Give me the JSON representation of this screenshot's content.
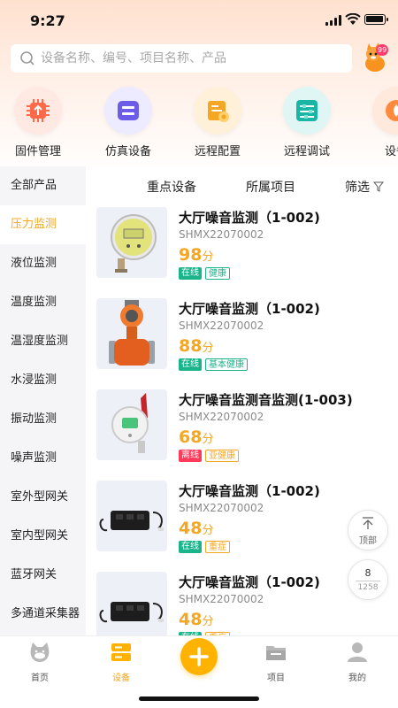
{
  "status_bar": {
    "time": "9:27"
  },
  "search": {
    "placeholder": "设备名称、编号、项目名称、产品",
    "badge": "99"
  },
  "quick_menu": [
    {
      "label": "固件管理",
      "icon": "firmware-icon"
    },
    {
      "label": "仿真设备",
      "icon": "simulated-device-icon"
    },
    {
      "label": "远程配置",
      "icon": "remote-config-icon"
    },
    {
      "label": "远程调试",
      "icon": "remote-debug-icon"
    },
    {
      "label": "设备",
      "icon": "device-icon"
    }
  ],
  "sidebar": {
    "items": [
      {
        "label": "全部产品",
        "active": false
      },
      {
        "label": "压力监测",
        "active": true
      },
      {
        "label": "液位监测",
        "active": false
      },
      {
        "label": "温度监测",
        "active": false
      },
      {
        "label": "温湿度监测",
        "active": false
      },
      {
        "label": "水浸监测",
        "active": false
      },
      {
        "label": "振动监测",
        "active": false
      },
      {
        "label": "噪声监测",
        "active": false
      },
      {
        "label": "室外型网关",
        "active": false
      },
      {
        "label": "室内型网关",
        "active": false
      },
      {
        "label": "蓝牙网关",
        "active": false
      },
      {
        "label": "多通道采集器",
        "active": false
      }
    ]
  },
  "filters": {
    "key_devices": "重点设备",
    "project": "所属项目",
    "filter": "筛选"
  },
  "products": [
    {
      "name": "大厅噪音监测（1-002)",
      "code": "SHMX22070002",
      "score": "98",
      "unit": "分",
      "status": "在线",
      "health": "健康",
      "status_type": "online",
      "health_type": "health",
      "image": "digital-pressure-gauge"
    },
    {
      "name": "大厅噪音监测（1-002)",
      "code": "SHMX22070002",
      "score": "88",
      "unit": "分",
      "status": "在线",
      "health": "基本健康",
      "status_type": "online",
      "health_type": "health",
      "image": "flow-meter"
    },
    {
      "name": "大厅噪音监测音监测(1-003)",
      "code": "SHMX22070002",
      "score": "68",
      "unit": "分",
      "status": "离线",
      "health": "亚健康",
      "status_type": "offline",
      "health_type": "warn",
      "image": "wireless-transmitter"
    },
    {
      "name": "大厅噪音监测（1-002)",
      "code": "SHMX22070002",
      "score": "48",
      "unit": "分",
      "status": "在线",
      "health": "重症",
      "status_type": "online",
      "health_type": "warn",
      "image": "battery-box"
    },
    {
      "name": "大厅噪音监测（1-002)",
      "code": "SHMX22070002",
      "score": "48",
      "unit": "分",
      "status": "在线",
      "health": "重症",
      "status_type": "online",
      "health_type": "warn",
      "image": "battery-box"
    }
  ],
  "float": {
    "top_label": "顶部",
    "page_current": "8",
    "page_total": "1258"
  },
  "bottom_nav": [
    {
      "label": "首页",
      "icon": "home-icon",
      "active": false
    },
    {
      "label": "设备",
      "icon": "device-icon",
      "active": true
    },
    {
      "label": "",
      "icon": "add-icon",
      "active": false
    },
    {
      "label": "项目",
      "icon": "folder-icon",
      "active": false
    },
    {
      "label": "我的",
      "icon": "profile-icon",
      "active": false
    }
  ],
  "colors": {
    "accent": "#f5a623",
    "online": "#1bb38a",
    "offline": "#ff3b5c"
  }
}
